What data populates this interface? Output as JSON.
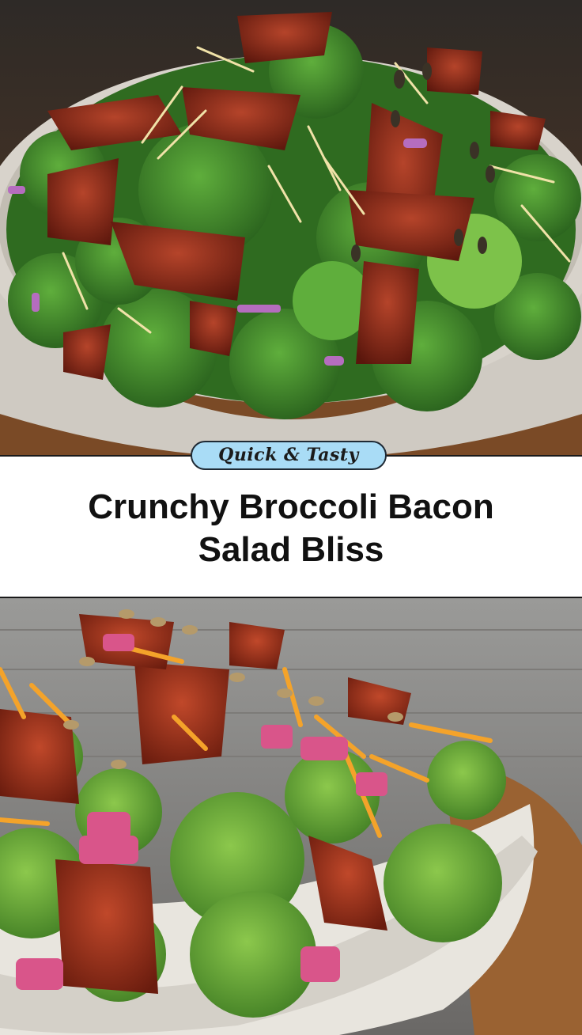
{
  "badge": {
    "label": "Quick & Tasty"
  },
  "title": {
    "line1": "Crunchy Broccoli Bacon",
    "line2": "Salad Bliss"
  },
  "photos": {
    "top": {
      "subject": "broccoli-bacon-salad-bowl-top-view"
    },
    "bottom": {
      "subject": "broccoli-bacon-salad-bowl-closeup"
    }
  },
  "colors": {
    "badge_fill": "#a9dcf6",
    "badge_border": "#1f2a35",
    "title_text": "#111111",
    "band_background": "#ffffff",
    "broccoli": "#3f8a2a",
    "bacon": "#8a2a18",
    "bowl": "#d9d6cf",
    "wood": "#8a5a32"
  }
}
